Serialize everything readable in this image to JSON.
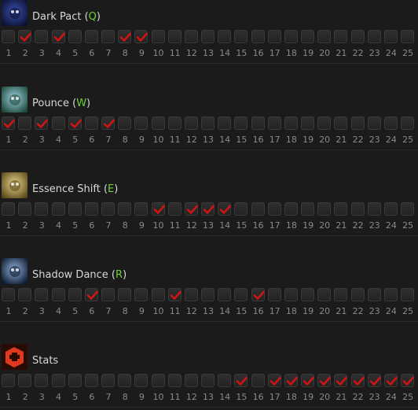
{
  "levels": [
    "1",
    "2",
    "3",
    "4",
    "5",
    "6",
    "7",
    "8",
    "9",
    "10",
    "11",
    "12",
    "13",
    "14",
    "15",
    "16",
    "17",
    "18",
    "19",
    "20",
    "21",
    "22",
    "23",
    "24",
    "25"
  ],
  "skills": [
    {
      "name": "Dark Pact",
      "hotkey": "Q",
      "icon": "dark-pact-icon",
      "icon_colors": [
        "#3a4fb0",
        "#0b1030"
      ],
      "levels_learned": [
        2,
        4,
        8,
        9
      ]
    },
    {
      "name": "Pounce",
      "hotkey": "W",
      "icon": "pounce-icon",
      "icon_colors": [
        "#9fd0e0",
        "#1e4a3a"
      ],
      "levels_learned": [
        1,
        3,
        5,
        7
      ]
    },
    {
      "name": "Essence Shift",
      "hotkey": "E",
      "icon": "essence-shift-icon",
      "icon_colors": [
        "#e8d38a",
        "#5a4a1a"
      ],
      "levels_learned": [
        10,
        12,
        13,
        14
      ]
    },
    {
      "name": "Shadow Dance",
      "hotkey": "R",
      "icon": "shadow-dance-icon",
      "icon_colors": [
        "#8fb0d8",
        "#0d1a30"
      ],
      "levels_learned": [
        6,
        11,
        16
      ]
    },
    {
      "name": "Stats",
      "hotkey": "",
      "icon": "stats-icon",
      "icon_colors": [
        "#e03a1e",
        "#7a1a0a"
      ],
      "levels_learned": [
        15,
        17,
        18,
        19,
        20,
        21,
        22,
        23,
        24,
        25
      ]
    }
  ],
  "colors": {
    "check": "#d01414",
    "hotkey": "#6fcf3a",
    "label": "#d8d8d8",
    "level_number": "#8a8a8a"
  }
}
